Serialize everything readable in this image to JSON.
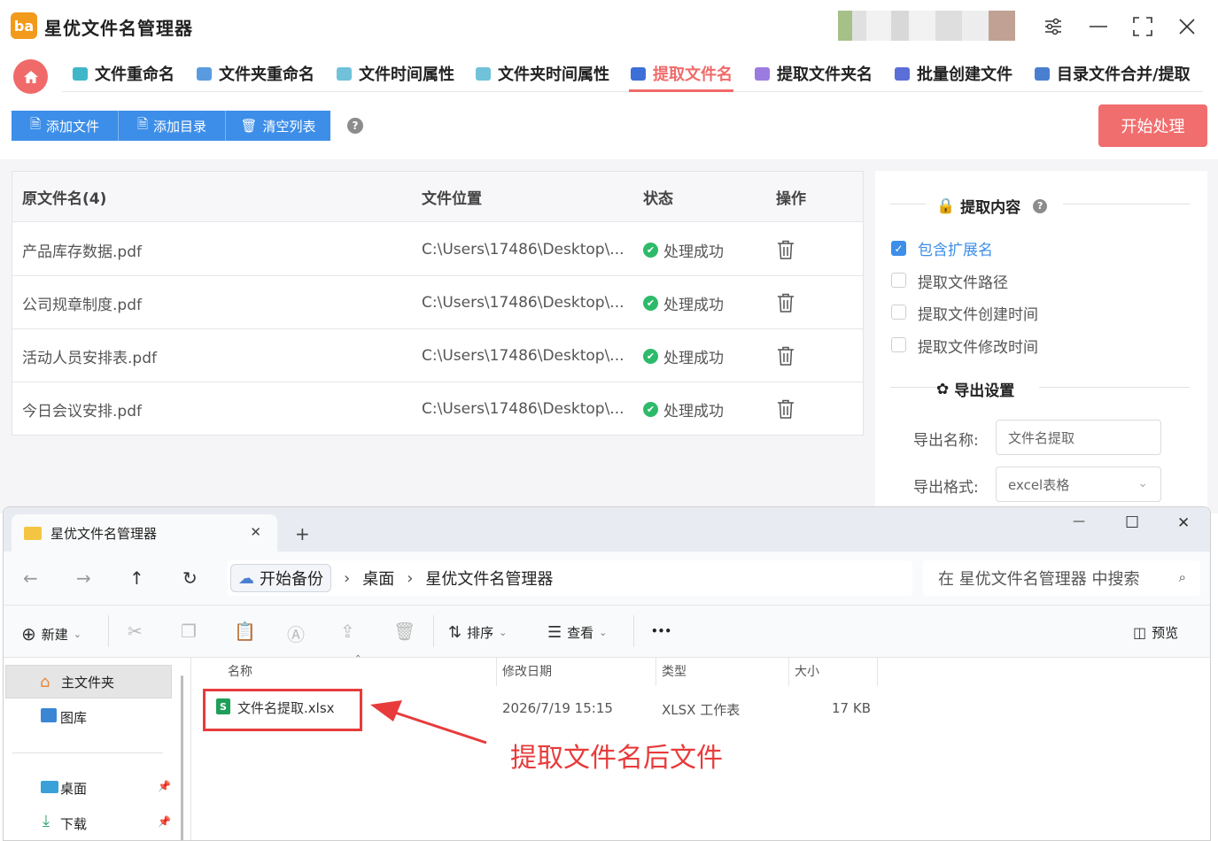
{
  "app": {
    "title": "星优文件名管理器",
    "logo_text": "ba"
  },
  "window_controls": {
    "settings": "⚙",
    "minimize": "—",
    "maximize": "⛶",
    "close": "✕"
  },
  "nav": {
    "home_icon": "home-icon",
    "items": [
      {
        "label": "文件重命名"
      },
      {
        "label": "文件夹重命名"
      },
      {
        "label": "文件时间属性"
      },
      {
        "label": "文件夹时间属性"
      },
      {
        "label": "提取文件名",
        "active": true
      },
      {
        "label": "提取文件夹名"
      },
      {
        "label": "批量创建文件"
      },
      {
        "label": "目录文件合并/提取"
      }
    ]
  },
  "toolbar": {
    "add_file": "添加文件",
    "add_dir": "添加目录",
    "clear_list": "清空列表",
    "help": "?",
    "start": "开始处理"
  },
  "table": {
    "headers": {
      "name": "原文件名(4)",
      "location": "文件位置",
      "status": "状态",
      "action": "操作"
    },
    "rows": [
      {
        "name": "产品库存数据.pdf",
        "location": "C:\\Users\\17486\\Desktop\\...",
        "status": "处理成功"
      },
      {
        "name": "公司规章制度.pdf",
        "location": "C:\\Users\\17486\\Desktop\\...",
        "status": "处理成功"
      },
      {
        "name": "活动人员安排表.pdf",
        "location": "C:\\Users\\17486\\Desktop\\...",
        "status": "处理成功"
      },
      {
        "name": "今日会议安排.pdf",
        "location": "C:\\Users\\17486\\Desktop\\...",
        "status": "处理成功"
      }
    ]
  },
  "panel": {
    "extract_title": "提取内容",
    "options": [
      {
        "label": "包含扩展名",
        "checked": true
      },
      {
        "label": "提取文件路径",
        "checked": false
      },
      {
        "label": "提取文件创建时间",
        "checked": false
      },
      {
        "label": "提取文件修改时间",
        "checked": false
      }
    ],
    "export_title": "导出设置",
    "export_name_label": "导出名称:",
    "export_name_value": "文件名提取",
    "export_format_label": "导出格式:",
    "export_format_value": "excel表格"
  },
  "explorer": {
    "tab_title": "星优文件名管理器",
    "tab_close": "✕",
    "new_tab": "+",
    "win_min": "—",
    "win_max": "☐",
    "win_close": "✕",
    "breadcrumb": {
      "root": "开始备份",
      "desktop": "桌面",
      "folder": "星优文件名管理器"
    },
    "search_placeholder": "在 星优文件名管理器 中搜索",
    "cmd": {
      "new": "新建",
      "sort": "排序",
      "view": "查看",
      "more": "•••",
      "preview": "预览"
    },
    "sidebar": {
      "home": "主文件夹",
      "gallery": "图库",
      "desktop": "桌面",
      "downloads": "下载"
    },
    "columns": {
      "name": "名称",
      "modified": "修改日期",
      "type": "类型",
      "size": "大小"
    },
    "files": [
      {
        "name": "文件名提取.xlsx",
        "modified": "2026/7/19 15:15",
        "type": "XLSX 工作表",
        "size": "17 KB"
      }
    ]
  },
  "annotation": {
    "text": "提取文件名后文件"
  },
  "colors": {
    "accent_red": "#f06a6a",
    "accent_blue": "#3d8ee8",
    "success": "#2dba6a",
    "annot_red": "#e83b3b"
  }
}
